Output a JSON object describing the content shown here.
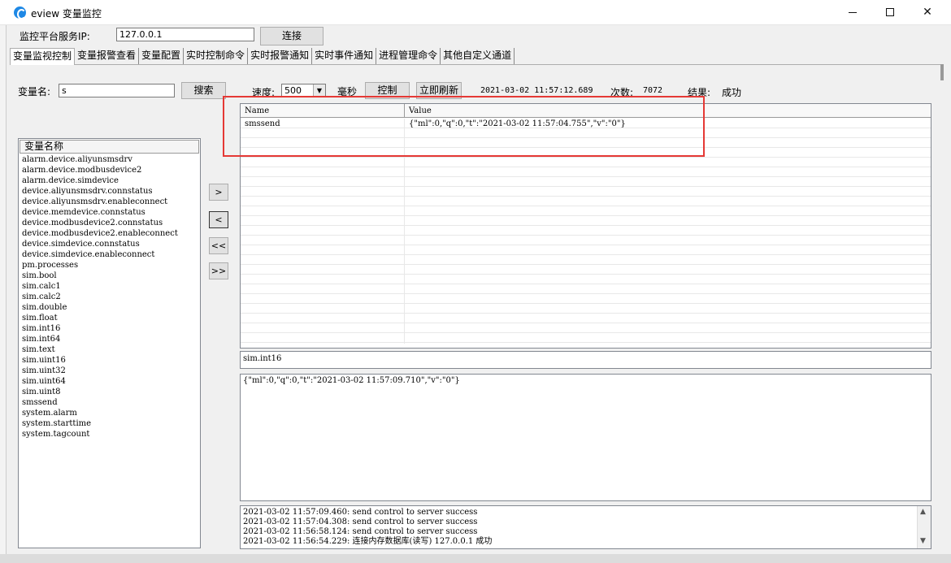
{
  "window": {
    "title": "eview 变量监控"
  },
  "connection": {
    "ip_label": "监控平台服务IP:",
    "ip_value": "127.0.0.1",
    "connect_label": "连接"
  },
  "tabs": [
    {
      "label": "变量监视控制",
      "active": true
    },
    {
      "label": "变量报警查看"
    },
    {
      "label": "变量配置"
    },
    {
      "label": "实时控制命令"
    },
    {
      "label": "实时报警通知"
    },
    {
      "label": "实时事件通知"
    },
    {
      "label": "进程管理命令"
    },
    {
      "label": "其他自定义通道"
    }
  ],
  "search": {
    "label": "变量名:",
    "value": "s",
    "button_label": "搜索"
  },
  "toolbar": {
    "speed_label": "速度:",
    "speed_value": "500",
    "ms_label": "毫秒",
    "control_label": "控制",
    "refresh_label": "立即刷新",
    "timestamp": "2021-03-02 11:57:12.689",
    "count_label": "次数:",
    "count_value": "7072",
    "result_label": "结果:",
    "result_value": "成功"
  },
  "var_list": {
    "header": "变量名称",
    "items": [
      "alarm.device.aliyunsmsdrv",
      "alarm.device.modbusdevice2",
      "alarm.device.simdevice",
      "device.aliyunsmsdrv.connstatus",
      "device.aliyunsmsdrv.enableconnect",
      "device.memdevice.connstatus",
      "device.modbusdevice2.connstatus",
      "device.modbusdevice2.enableconnect",
      "device.simdevice.connstatus",
      "device.simdevice.enableconnect",
      "pm.processes",
      "sim.bool",
      "sim.calc1",
      "sim.calc2",
      "sim.double",
      "sim.float",
      "sim.int16",
      "sim.int64",
      "sim.text",
      "sim.uint16",
      "sim.uint32",
      "sim.uint64",
      "sim.uint8",
      "smssend",
      "system.alarm",
      "system.starttime",
      "system.tagcount"
    ]
  },
  "move_buttons": {
    "add_one": ">",
    "remove_one": "<",
    "remove_all": "<<",
    "add_all": ">>"
  },
  "grid": {
    "columns": [
      "Name",
      "Value"
    ],
    "rows": [
      {
        "name": "smssend",
        "value": "{\"ml\":0,\"q\":0,\"t\":\"2021-03-02 11:57:04.755\",\"v\":\"0\"}"
      }
    ]
  },
  "selected_var": "sim.int16",
  "selected_value": "{\"ml\":0,\"q\":0,\"t\":\"2021-03-02 11:57:09.710\",\"v\":\"0\"}",
  "log": [
    "2021-03-02 11:57:09.460: send control to server success",
    "2021-03-02 11:57:04.308: send control to server success",
    "2021-03-02 11:56:58.124: send control to server success",
    "2021-03-02 11:56:54.229: 连接内存数据库(读写) 127.0.0.1 成功"
  ],
  "colors": {
    "highlight": "#e53935",
    "accent": "#1e88e5"
  }
}
